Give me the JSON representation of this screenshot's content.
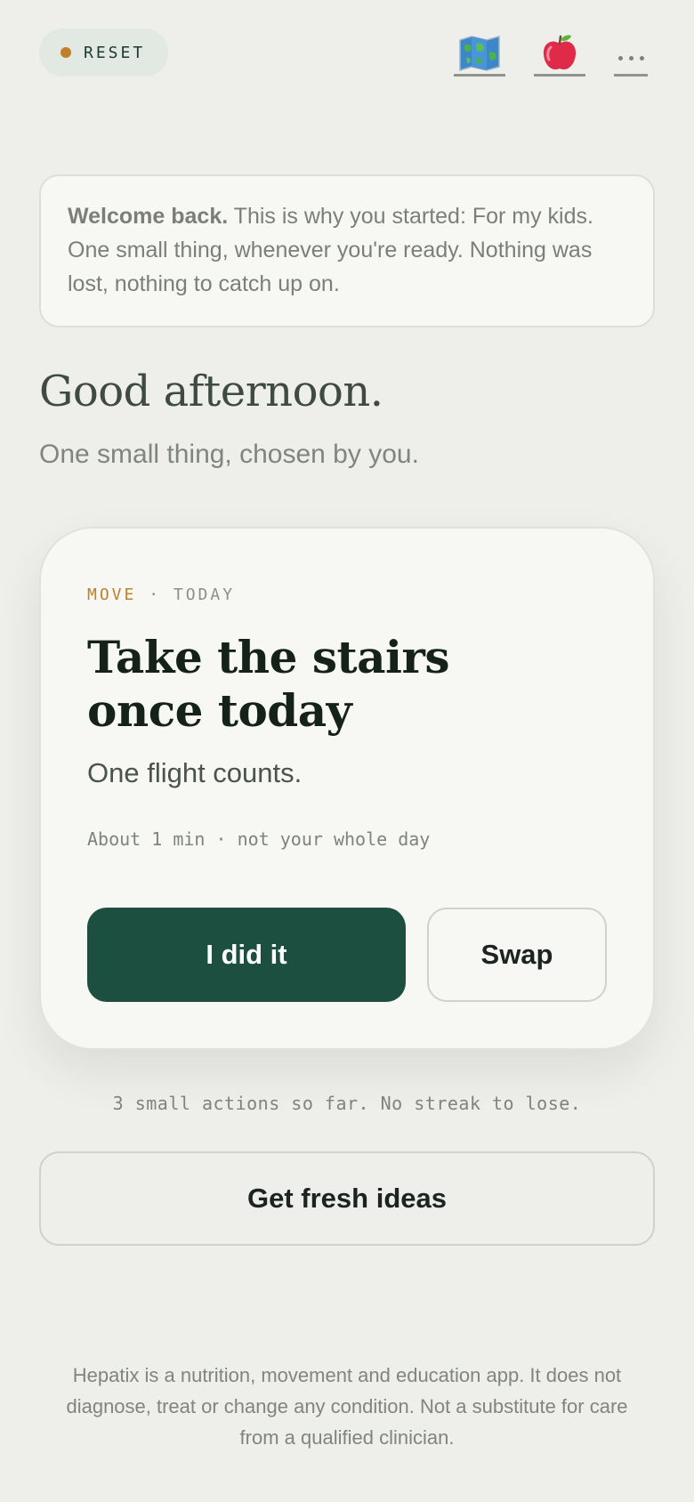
{
  "header": {
    "reset_label": "RESET",
    "map_icon": "map-icon",
    "apple_icon": "apple-icon",
    "more_icon": "more-icon"
  },
  "welcome": {
    "lead": "Welcome back.",
    "body": " This is why you started: For my kids. One small thing, whenever you're ready. Nothing was lost, nothing to catch up on."
  },
  "greeting": {
    "title": "Good afternoon.",
    "subtitle": "One small thing, chosen by you."
  },
  "task": {
    "category": "MOVE",
    "separator": " · ",
    "when": "TODAY",
    "title": "Take the stairs once today",
    "description": "One flight counts.",
    "duration": "About 1 min · not your whole day",
    "primary_label": "I did it",
    "secondary_label": "Swap"
  },
  "progress_note": "3 small actions so far. No streak to lose.",
  "fresh_ideas_label": "Get fresh ideas",
  "disclaimer": "Hepatix is a nutrition, movement and education app. It does not diagnose, treat or change any condition. Not a substitute for care from a qualified clinician.",
  "colors": {
    "background": "#eeeeea",
    "accent_orange": "#c07f2a",
    "primary_green": "#1c4f40",
    "card": "#f7f8f4"
  }
}
